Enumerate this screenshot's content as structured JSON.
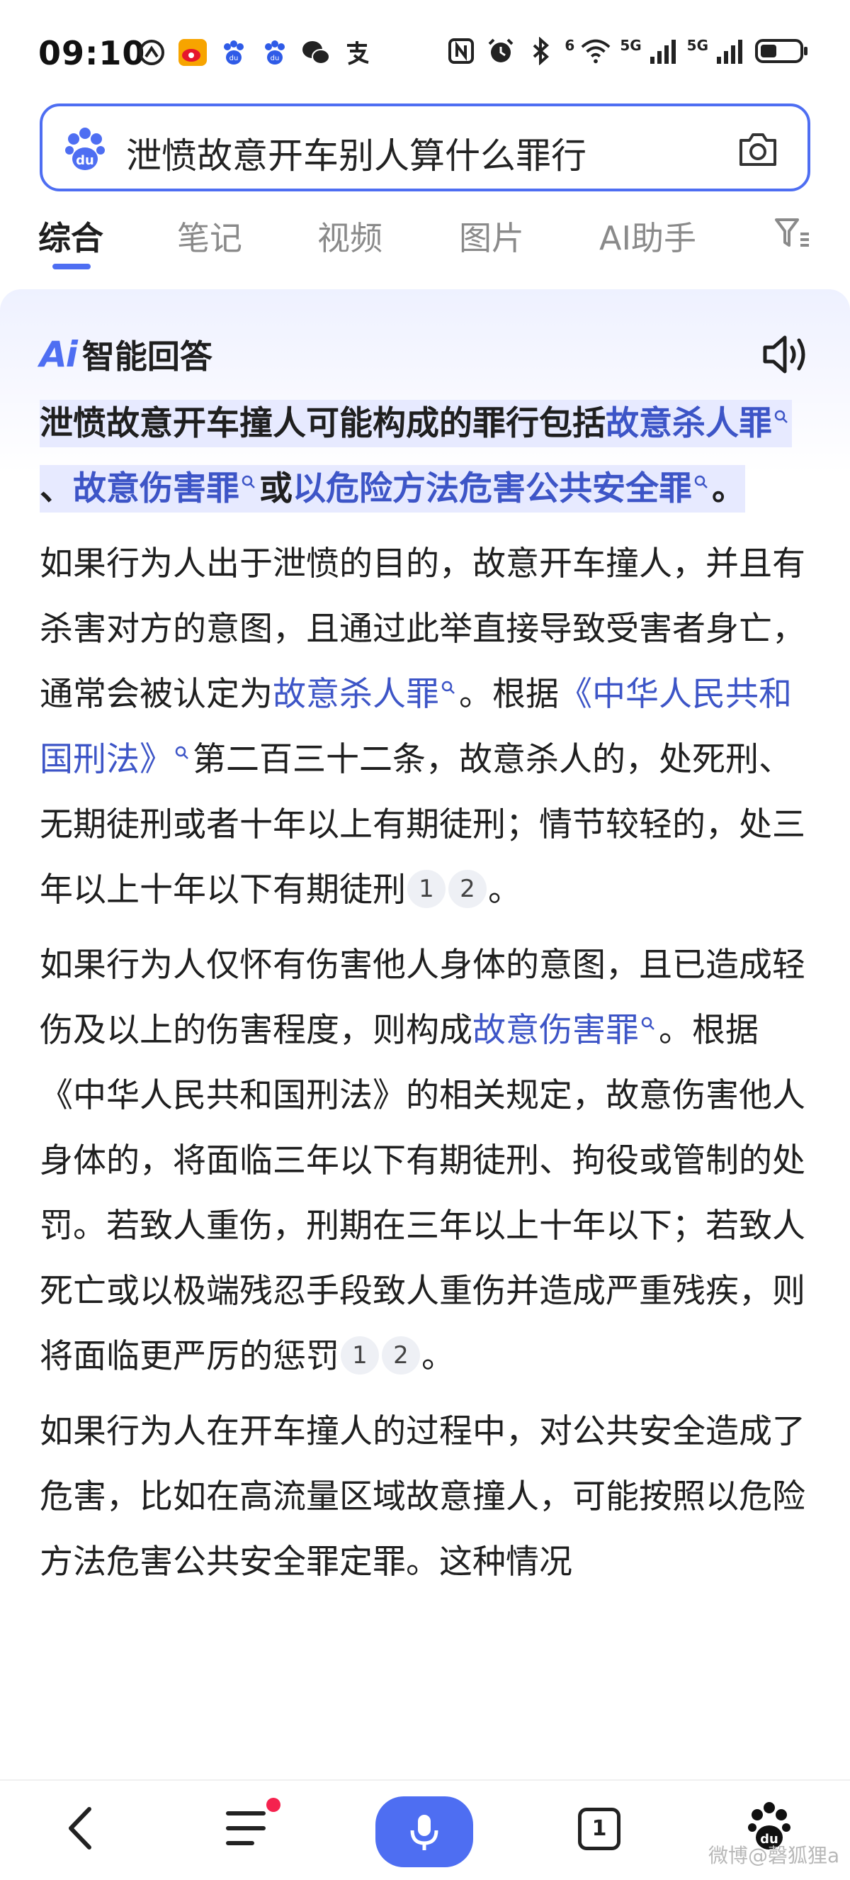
{
  "status_bar": {
    "time": "09:10",
    "net_label_1": "5G",
    "net_label_2": "5G",
    "wifi_label": "6"
  },
  "search": {
    "query": "泄愤故意开车别人算什么罪行"
  },
  "tabs": [
    {
      "label": "综合",
      "active": true
    },
    {
      "label": "笔记"
    },
    {
      "label": "视频"
    },
    {
      "label": "图片"
    },
    {
      "label": "AI助手"
    }
  ],
  "answer": {
    "logo_text": "Ai",
    "title": "智能回答",
    "p1": {
      "t1": "泄愤故意开车撞人可能构成的罪行包括",
      "l1": "故意杀人罪",
      "t2": "、",
      "l2": "故意伤害罪",
      "t3": "或",
      "l3": "以危险方法危害公共安全罪",
      "t4": "。"
    },
    "p2": {
      "t1": "如果行为人出于泄愤的目的，故意开车撞人，并且有杀害对方的意图，且通过此举直接导致受害者身亡，通常会被认定为",
      "l1": "故意杀人罪",
      "t2": "。根据",
      "l2": "《中华人民共和国刑法》",
      "t3": "第二百三十二条，故意杀人的，处死刑、无期徒刑或者十年以上有期徒刑；情节较轻的，处三年以上十年以下有期徒刑",
      "c1": "1",
      "c2": "2",
      "t4": "。"
    },
    "p3": {
      "t1": "如果行为人仅怀有伤害他人身体的意图，且已造成轻伤及以上的伤害程度，则构成",
      "l1": "故意伤害罪",
      "t2": "。根据《中华人民共和国刑法》的相关规定，故意伤害他人身体的，将面临三年以下有期徒刑、拘役或管制的处罚。若致人重伤，刑期在三年以上十年以下；若致人死亡或以极端残忍手段致人重伤并造成严重残疾，则将面临更严厉的惩罚",
      "c1": "1",
      "c2": "2",
      "t3": "。"
    },
    "p4": {
      "t1": "如果行为人在开车撞人的过程中，对公共安全造成了危害，比如在高流量区域故意撞人，可能按照以危险方法危害公共安全罪定罪。这种情况"
    }
  },
  "bottom_nav": {
    "tabs_count": "1"
  },
  "watermark": "微博@磬狐狸a",
  "colors": {
    "accent": "#4e6ef2",
    "link": "#3d55c7",
    "highlight": "#e7eaff",
    "badge_dot": "#f5224e"
  }
}
